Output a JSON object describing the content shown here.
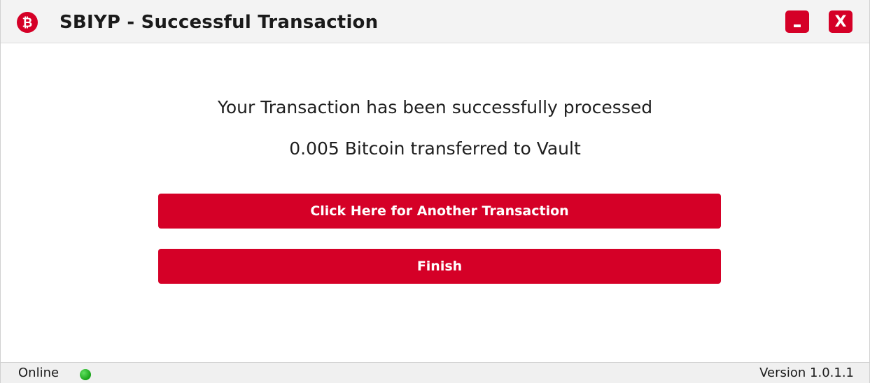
{
  "window": {
    "title": "SBIYP - Successful Transaction",
    "icon": "bitcoin-icon",
    "minimize_label": "_",
    "close_label": "X"
  },
  "message": {
    "line1": "Your Transaction has been successfully processed",
    "line2": "0.005 Bitcoin transferred to Vault"
  },
  "buttons": {
    "another_transaction": "Click Here for Another Transaction",
    "finish": "Finish"
  },
  "status": {
    "connection": "Online",
    "version": "Version 1.0.1.1"
  },
  "colors": {
    "accent": "#d50027",
    "online": "#22b022"
  }
}
